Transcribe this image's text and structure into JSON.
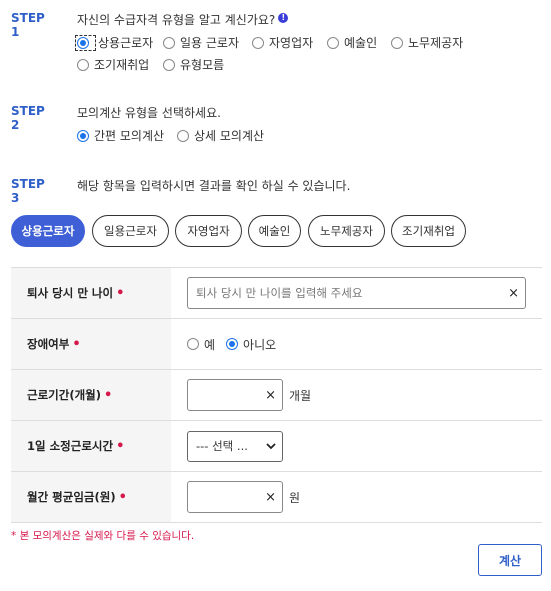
{
  "step1": {
    "label": "STEP 1",
    "question": "자신의 수급자격 유형을 알고 계신가요?",
    "info_icon": "!",
    "options": [
      "상용근로자",
      "일용 근로자",
      "자영업자",
      "예술인",
      "노무제공자",
      "조기재취업",
      "유형모름"
    ],
    "selected": "상용근로자"
  },
  "step2": {
    "label": "STEP 2",
    "question": "모의계산 유형을 선택하세요.",
    "options": [
      "간편 모의계산",
      "상세 모의계산"
    ],
    "selected": "간편 모의계산"
  },
  "step3": {
    "label": "STEP 3",
    "question": "해당 항목을 입력하시면 결과를 확인 하실 수 있습니다.",
    "tabs": [
      "상용근로자",
      "일용근로자",
      "자영업자",
      "예술인",
      "노무제공자",
      "조기재취업"
    ],
    "active_tab": "상용근로자"
  },
  "form": {
    "required_mark": "•",
    "age": {
      "label": "퇴사 당시 만 나이",
      "placeholder": "퇴사 당시 만 나이를 입력해 주세요",
      "clear": "×"
    },
    "disability": {
      "label": "장애여부",
      "options": [
        "예",
        "아니오"
      ],
      "selected": "아니오"
    },
    "period": {
      "label": "근로기간(개월)",
      "clear": "×",
      "unit": "개월"
    },
    "hours": {
      "label": "1일 소정근로시간",
      "selected": "--- 선택 ..."
    },
    "wage": {
      "label": "월간 평균임금(원)",
      "clear": "×",
      "unit": "원"
    }
  },
  "note": "* 본 모의계산은 실제와 다를 수 있습니다.",
  "calc_button": "계산",
  "colors": {
    "accent": "#3f5fd6",
    "required": "#d6174b",
    "step": "#2f5fc8"
  }
}
